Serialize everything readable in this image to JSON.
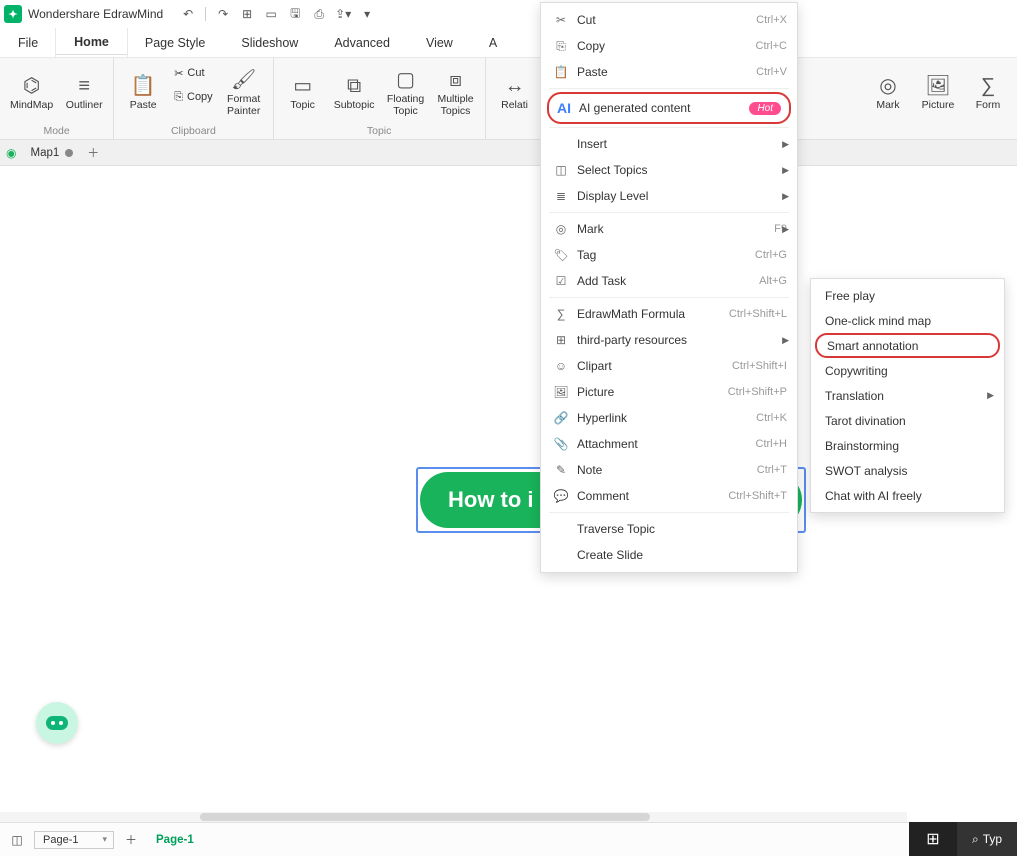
{
  "title": "Wondershare EdrawMind",
  "menu_tabs": [
    "File",
    "Home",
    "Page Style",
    "Slideshow",
    "Advanced",
    "View",
    "A"
  ],
  "active_tab_index": 1,
  "ribbon": {
    "mode_group": "Mode",
    "mindmap": "MindMap",
    "outliner": "Outliner",
    "clipboard_group": "Clipboard",
    "paste": "Paste",
    "cut": "Cut",
    "copy": "Copy",
    "format_painter": "Format\nPainter",
    "topic_group": "Topic",
    "topic": "Topic",
    "subtopic": "Subtopic",
    "floating_topic": "Floating\nTopic",
    "multiple_topics": "Multiple\nTopics",
    "relati": "Relati",
    "mark": "Mark",
    "picture": "Picture",
    "form": "Form"
  },
  "doc_tab": "Map1",
  "canvas_node": "How to i",
  "context_menu": {
    "cut": {
      "label": "Cut",
      "shortcut": "Ctrl+X"
    },
    "copy": {
      "label": "Copy",
      "shortcut": "Ctrl+C"
    },
    "paste": {
      "label": "Paste",
      "shortcut": "Ctrl+V"
    },
    "ai": {
      "label": "AI generated content",
      "badge": "Hot"
    },
    "insert": {
      "label": "Insert"
    },
    "select_topics": {
      "label": "Select Topics"
    },
    "display_level": {
      "label": "Display Level"
    },
    "mark": {
      "label": "Mark",
      "shortcut": "F9"
    },
    "tag": {
      "label": "Tag",
      "shortcut": "Ctrl+G"
    },
    "add_task": {
      "label": "Add Task",
      "shortcut": "Alt+G"
    },
    "formula": {
      "label": "EdrawMath Formula",
      "shortcut": "Ctrl+Shift+L"
    },
    "third_party": {
      "label": "third-party resources"
    },
    "clipart": {
      "label": "Clipart",
      "shortcut": "Ctrl+Shift+I"
    },
    "picture": {
      "label": "Picture",
      "shortcut": "Ctrl+Shift+P"
    },
    "hyperlink": {
      "label": "Hyperlink",
      "shortcut": "Ctrl+K"
    },
    "attachment": {
      "label": "Attachment",
      "shortcut": "Ctrl+H"
    },
    "note": {
      "label": "Note",
      "shortcut": "Ctrl+T"
    },
    "comment": {
      "label": "Comment",
      "shortcut": "Ctrl+Shift+T"
    },
    "traverse": {
      "label": "Traverse Topic"
    },
    "create_slide": {
      "label": "Create Slide"
    }
  },
  "submenu": {
    "free_play": "Free play",
    "one_click": "One-click mind map",
    "smart_annotation": "Smart annotation",
    "copywriting": "Copywriting",
    "translation": "Translation",
    "tarot": "Tarot divination",
    "brainstorming": "Brainstorming",
    "swot": "SWOT analysis",
    "chat": "Chat with AI freely"
  },
  "status": {
    "page_sel": "Page-1",
    "page_tab": "Page-1"
  },
  "taskbar": {
    "search": "Typ"
  }
}
